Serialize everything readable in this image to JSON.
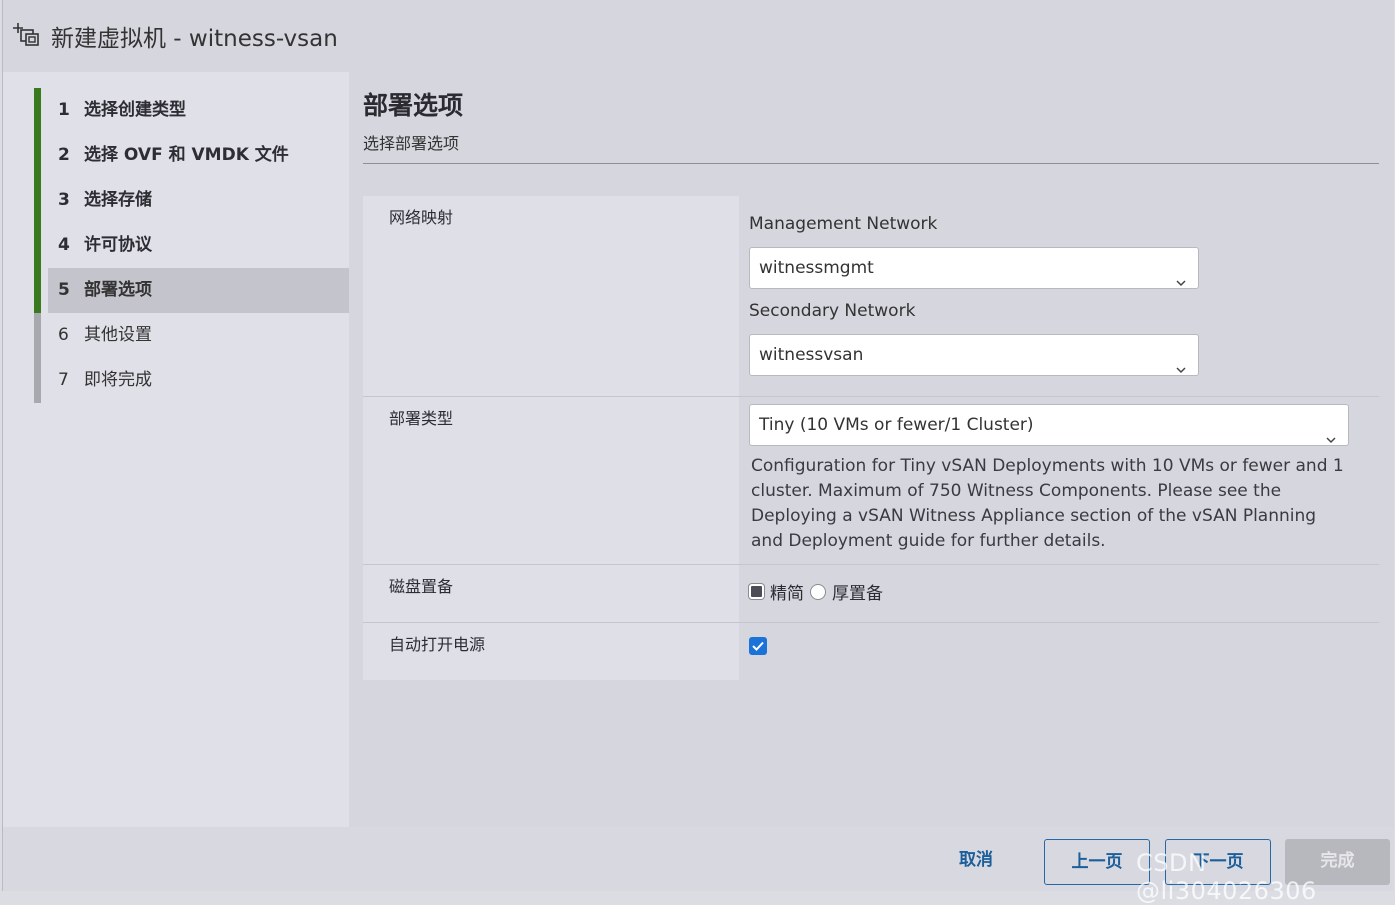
{
  "window": {
    "title": "新建虚拟机 - witness-vsan",
    "icon": "new-vm-icon"
  },
  "steps": [
    {
      "num": "1",
      "label": "选择创建类型",
      "state": "done"
    },
    {
      "num": "2",
      "label": "选择 OVF 和 VMDK 文件",
      "state": "done"
    },
    {
      "num": "3",
      "label": "选择存储",
      "state": "done"
    },
    {
      "num": "4",
      "label": "许可协议",
      "state": "done"
    },
    {
      "num": "5",
      "label": "部署选项",
      "state": "active"
    },
    {
      "num": "6",
      "label": "其他设置",
      "state": "todo"
    },
    {
      "num": "7",
      "label": "即将完成",
      "state": "todo"
    }
  ],
  "page": {
    "title": "部署选项",
    "subtitle": "选择部署选项"
  },
  "form": {
    "network_mapping": {
      "label": "网络映射",
      "management_label": "Management Network",
      "management_value": "witnessmgmt",
      "secondary_label": "Secondary Network",
      "secondary_value": "witnessvsan"
    },
    "deployment_type": {
      "label": "部署类型",
      "value": "Tiny (10 VMs or fewer/1 Cluster)",
      "description": "Configuration for Tiny vSAN Deployments with 10 VMs or fewer and 1 cluster. Maximum of 750 Witness Components. Please see the Deploying a vSAN Witness Appliance section of the vSAN Planning and Deployment guide for further details."
    },
    "disk_provisioning": {
      "label": "磁盘置备",
      "option_thin": "精简",
      "option_thick": "厚置备",
      "selected": "精简"
    },
    "power_on": {
      "label": "自动打开电源",
      "checked": true
    }
  },
  "footer": {
    "cancel": "取消",
    "back": "上一页",
    "next": "下一页",
    "finish": "完成"
  },
  "watermark": "CSDN @li304026306",
  "colors": {
    "step_done": "#3a7a1e",
    "step_todo": "#a8a9ae",
    "accent": "#1b5e9a",
    "checkbox": "#1a73d9"
  }
}
